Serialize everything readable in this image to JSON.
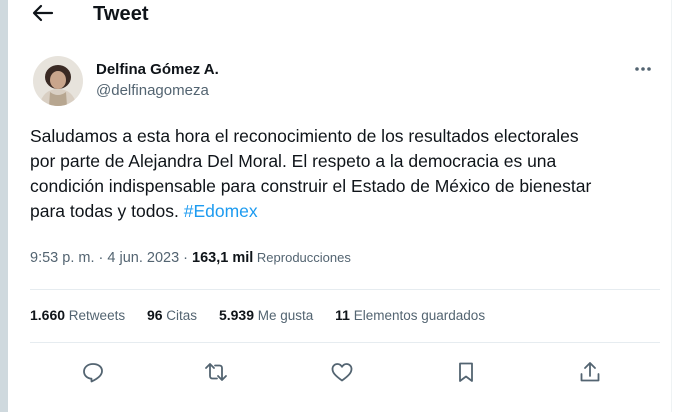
{
  "header": {
    "title": "Tweet",
    "back_icon": "arrow-left-icon"
  },
  "author": {
    "name": "Delfina Gómez A.",
    "handle": "@delfinagomeza",
    "more_icon": "more-horizontal-icon"
  },
  "tweet": {
    "text_lines": [
      "Saludamos a esta hora el reconocimiento de los resultados electorales",
      "por parte de Alejandra Del Moral. El respeto a la democracia es una",
      "condición indispensable para construir el Estado de México de bienestar",
      "para todas y todos. "
    ],
    "hashtag": "#Edomex"
  },
  "meta": {
    "time": "9:53 p. m.",
    "separator1": " · ",
    "date": "4 jun. 2023",
    "separator2": " · ",
    "views_count": "163,1 mil",
    "views_label": " Reproducciones"
  },
  "stats": [
    {
      "count": "1.660",
      "label": " Retweets"
    },
    {
      "count": "96",
      "label": " Citas"
    },
    {
      "count": "5.939",
      "label": " Me gusta"
    },
    {
      "count": "11",
      "label": " Elementos guardados"
    }
  ],
  "actions": [
    "reply-icon",
    "retweet-icon",
    "like-icon",
    "bookmark-icon",
    "share-icon"
  ],
  "colors": {
    "accent": "#1d9bf0",
    "text": "#0f1419",
    "secondary": "#536471",
    "divider": "#e6ecf0"
  }
}
